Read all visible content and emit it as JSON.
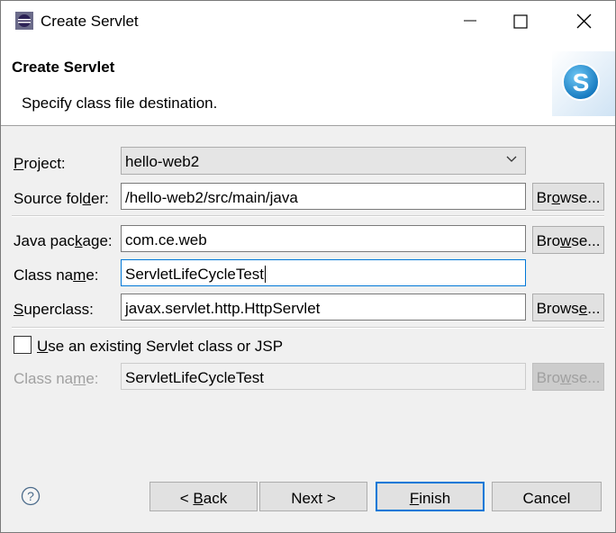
{
  "window": {
    "title": "Create Servlet",
    "minimize_icon": "minimize-icon",
    "maximize_icon": "maximize-icon",
    "close_icon": "close-icon"
  },
  "banner": {
    "title": "Create Servlet",
    "description": "Specify class file destination.",
    "logo_icon": "servlet-s-logo-icon"
  },
  "form": {
    "project": {
      "label_pre": "",
      "label_mn": "P",
      "label_post": "roject:",
      "value": "hello-web2"
    },
    "source_folder": {
      "label_pre": "Source fol",
      "label_mn": "d",
      "label_post": "er:",
      "value": "/hello-web2/src/main/java",
      "browse_pre": "Br",
      "browse_mn": "o",
      "browse_post": "wse..."
    },
    "java_package": {
      "label_pre": "Java pac",
      "label_mn": "k",
      "label_post": "age:",
      "value": "com.ce.web",
      "browse_pre": "Bro",
      "browse_mn": "w",
      "browse_post": "se..."
    },
    "class_name": {
      "label_pre": "Class na",
      "label_mn": "m",
      "label_post": "e:",
      "value": "ServletLifeCycleTest"
    },
    "superclass": {
      "label_pre": "",
      "label_mn": "S",
      "label_post": "uperclass:",
      "value": "javax.servlet.http.HttpServlet",
      "browse_pre": "Brows",
      "browse_mn": "e",
      "browse_post": "..."
    },
    "existing": {
      "checkbox_label_pre": "",
      "checkbox_label_mn": "U",
      "checkbox_label_post": "se an existing Servlet class or JSP",
      "checked": false
    },
    "existing_class_name": {
      "label_pre": "Class na",
      "label_mn": "m",
      "label_post": "e:",
      "value": "ServletLifeCycleTest",
      "browse_pre": "Bro",
      "browse_mn": "w",
      "browse_post": "se..."
    }
  },
  "footer": {
    "help_icon": "help-icon",
    "back": {
      "pre": "< ",
      "mn": "B",
      "post": "ack"
    },
    "next": {
      "label": "Next >"
    },
    "finish": {
      "pre": "",
      "mn": "F",
      "post": "inish"
    },
    "cancel": {
      "label": "Cancel"
    }
  }
}
